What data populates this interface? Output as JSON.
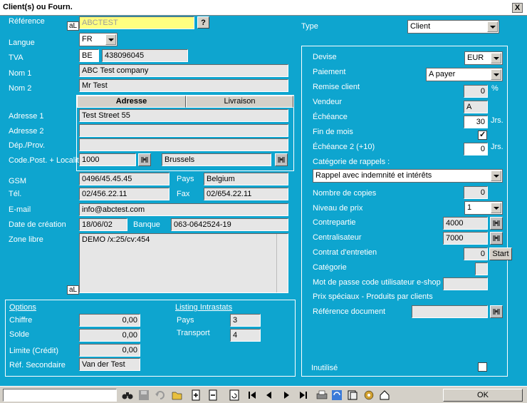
{
  "window": {
    "title": "Client(s) ou Fourn.",
    "close": "X"
  },
  "left": {
    "reference_label": "Référence",
    "reference_value": "ABCTEST",
    "al_badge": "aL",
    "help_btn": "?",
    "langue_label": "Langue",
    "langue_value": "FR",
    "tva_label": "TVA",
    "tva_country": "BE",
    "tva_number": "438096045",
    "nom1_label": "Nom 1",
    "nom1_value": "ABC Test company",
    "nom2_label": "Nom 2",
    "nom2_value": "Mr Test",
    "tabs": [
      "Adresse",
      "Livraison"
    ],
    "adresse1_label": "Adresse 1",
    "adresse1_value": "Test Street 55",
    "adresse2_label": "Adresse 2",
    "adresse2_value": "",
    "dep_label": "Dép./Prov.",
    "dep_value": "",
    "codepost_label": "Code.Post. + Localit",
    "codepost_value": "1000",
    "localite_value": "Brussels",
    "gsm_label": "GSM",
    "gsm_value": "0496/45.45.45",
    "pays_label": "Pays",
    "pays_value": "Belgium",
    "tel_label": "Tél.",
    "tel_value": "02/456.22.11",
    "fax_label": "Fax",
    "fax_value": "02/654.22.11",
    "email_label": "E-mail",
    "email_value": "info@abctest.com",
    "date_label": "Date de création",
    "date_value": "18/06/02",
    "banque_label": "Banque",
    "banque_value": "063-0642524-19",
    "zone_label": "Zone libre",
    "zone_value": "DEMO /x:25/cv:454",
    "zone_al": "aL"
  },
  "options": {
    "title": "Options",
    "chiffre_label": "Chiffre",
    "chiffre_value": "0,00",
    "solde_label": "Solde",
    "solde_value": "0,00",
    "limite_label": "Limite (Crédit)",
    "limite_value": "0,00",
    "refsec_label": "Réf. Secondaire",
    "refsec_value": "Van der Test",
    "listing_title": "Listing Intrastats",
    "pays_label": "Pays",
    "pays_value": "3",
    "transport_label": "Transport",
    "transport_value": "4"
  },
  "right": {
    "type_label": "Type",
    "type_value": "Client",
    "devise_label": "Devise",
    "devise_value": "EUR",
    "paiement_label": "Paiement",
    "paiement_value": "A payer",
    "remise_label": "Remise client",
    "remise_value": "0",
    "remise_unit": "%",
    "vendeur_label": "Vendeur",
    "vendeur_value": "A",
    "echeance_label": "Échéance",
    "echeance_value": "30",
    "jrs": "Jrs.",
    "finmois_label": "Fin de mois",
    "finmois_checked": true,
    "echeance2_label": "Échéance 2 (+10)",
    "echeance2_value": "0",
    "categorie_rappels_label": "Catégorie de rappels :",
    "categorie_rappels_value": "Rappel avec indemnité et intérêts",
    "copies_label": "Nombre de copies",
    "copies_value": "0",
    "niveau_label": "Niveau de prix",
    "niveau_value": "1",
    "contrepartie_label": "Contrepartie",
    "contrepartie_value": "4000",
    "centralisateur_label": "Centralisateur",
    "centralisateur_value": "7000",
    "contrat_label": "Contrat d'entretien",
    "contrat_value": "0",
    "start_btn": "Start",
    "categorie_label": "Catégorie",
    "categorie_value": "",
    "mdp_label": "Mot de passe code utilisateur e-shop",
    "mdp_value": "",
    "prix_label": "Prix spéciaux - Produits par clients",
    "refdoc_label": "Référence document",
    "refdoc_value": "",
    "inutilise_label": "Inutilisé"
  },
  "bottom": {
    "ok_btn": "OK",
    "search_value": ""
  }
}
